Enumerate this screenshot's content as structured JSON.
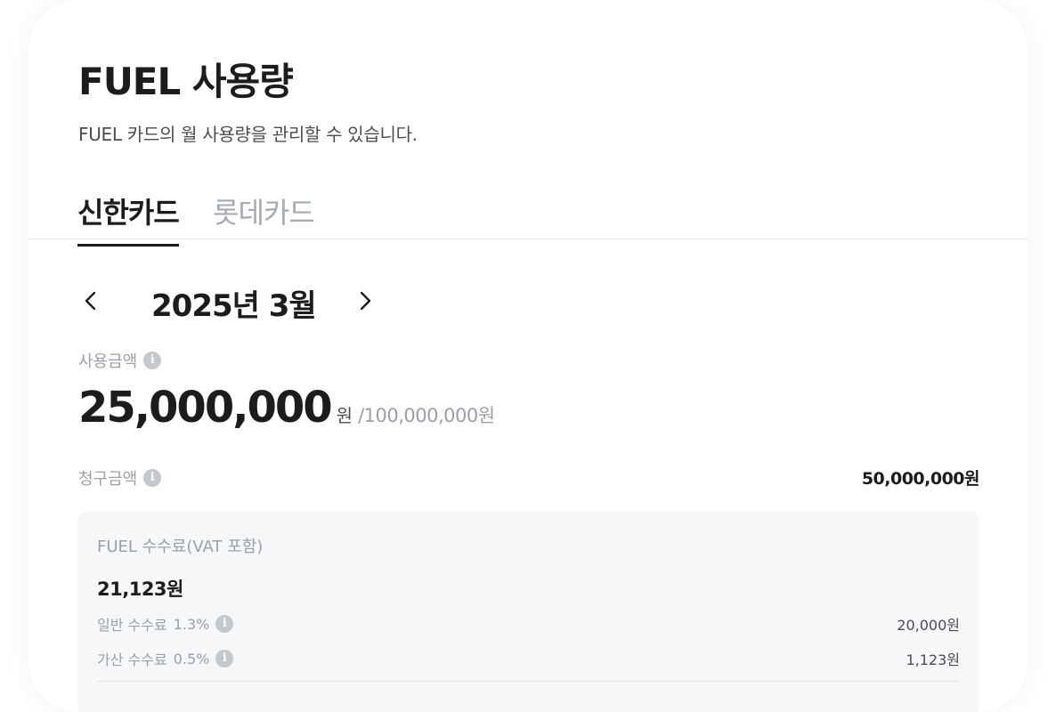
{
  "header": {
    "title": "FUEL 사용량",
    "subtitle": "FUEL 카드의 월 사용량을 관리할 수 있습니다."
  },
  "tabs": [
    {
      "label": "신한카드",
      "active": true
    },
    {
      "label": "롯데카드",
      "active": false
    }
  ],
  "month_nav": {
    "label": "2025년 3월",
    "prev_icon": "chevron-left-icon",
    "next_icon": "chevron-right-icon"
  },
  "usage": {
    "label": "사용금액",
    "amount": "25,000,000",
    "unit": "원",
    "limit": "/100,000,000원"
  },
  "billing": {
    "label": "청구금액",
    "amount": "50,000,000원"
  },
  "fee": {
    "title": "FUEL 수수료(VAT 포함)",
    "total": "21,123원",
    "rows": [
      {
        "label": "일반 수수료",
        "rate": "1.3%",
        "amount": "20,000원"
      },
      {
        "label": "가산 수수료",
        "rate": "0.5%",
        "amount": "1,123원"
      }
    ]
  },
  "colors": {
    "primary_text": "#1b1c1e",
    "muted_text": "#9aa0a8",
    "fee_background": "#f6f7f9",
    "info_icon": "#c4c8cd"
  }
}
